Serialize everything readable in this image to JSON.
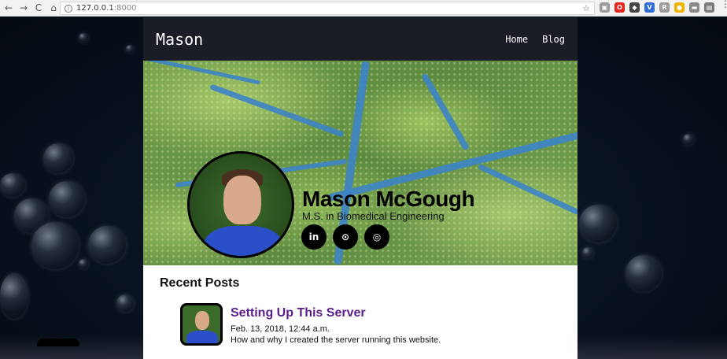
{
  "browser": {
    "url_host": "127.0.0.1",
    "url_port": ":8000",
    "nav": {
      "back": "←",
      "forward": "→",
      "reload": "C",
      "home": "⌂"
    },
    "star": "☆",
    "extensions": [
      {
        "glyph": "▣",
        "color": "#9a9a9a"
      },
      {
        "glyph": "O",
        "color": "#e3261b"
      },
      {
        "glyph": "◆",
        "color": "#444444"
      },
      {
        "glyph": "V",
        "color": "#2f6cd6"
      },
      {
        "glyph": "R",
        "color": "#9c9c9c"
      },
      {
        "glyph": "●",
        "color": "#f0b400"
      },
      {
        "glyph": "▬",
        "color": "#8a8a8a"
      },
      {
        "glyph": "▤",
        "color": "#7a7a7a"
      }
    ],
    "menu": "⋮"
  },
  "site": {
    "brand": "Mason",
    "nav": [
      "Home",
      "Blog"
    ],
    "hero": {
      "name": "Mason McGough",
      "subtitle": "M.S. in Biomedical Engineering",
      "socials": [
        {
          "icon": "linkedin-icon",
          "label": "in"
        },
        {
          "icon": "github-icon",
          "label": "⊙"
        },
        {
          "icon": "instagram-icon",
          "label": "◎"
        }
      ]
    },
    "recent": {
      "title": "Recent Posts",
      "posts": [
        {
          "title": "Setting Up This Server",
          "date": "Feb. 13, 2018, 12:44 a.m.",
          "desc": "How and why I created the server running this website."
        }
      ]
    }
  },
  "colors": {
    "topbar": "#1a1d26",
    "post_title": "#5a1f8a",
    "vein": "#3d84c7"
  }
}
